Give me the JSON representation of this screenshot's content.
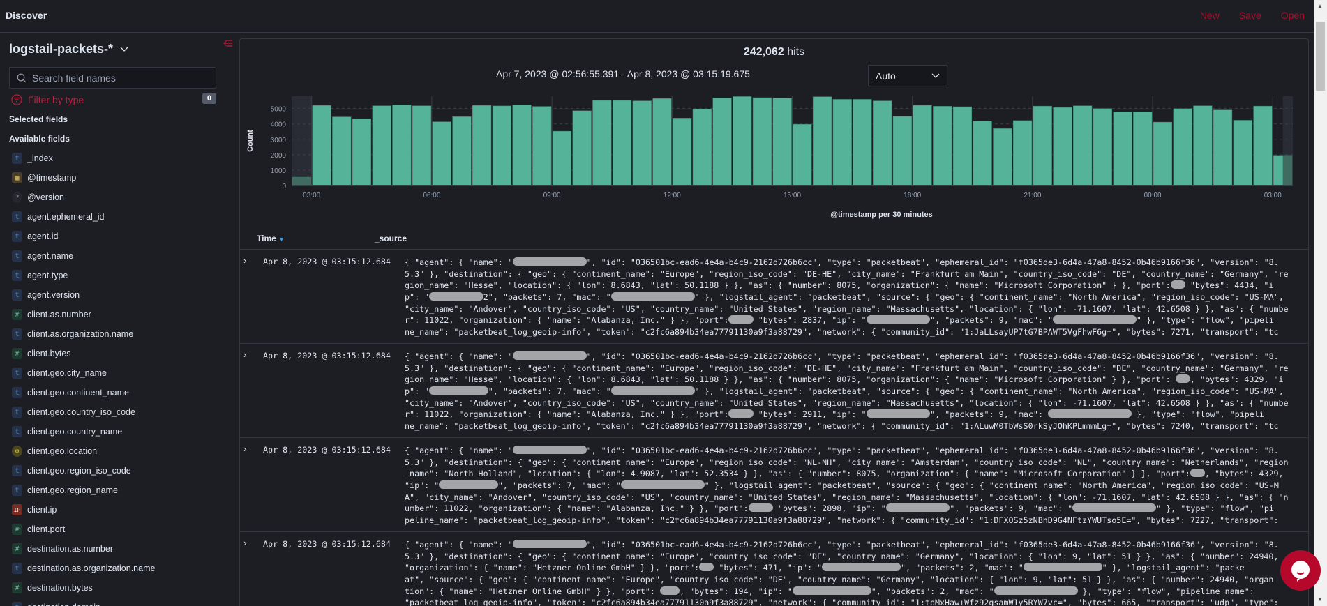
{
  "header": {
    "title": "Discover",
    "actions": [
      "New",
      "Save",
      "Open"
    ]
  },
  "sidebar": {
    "index_pattern": "logstail-packets-*",
    "search_placeholder": "Search field names",
    "filter_label": "Filter by type",
    "filter_count": "0",
    "selected_label": "Selected fields",
    "available_label": "Available fields",
    "fields": [
      {
        "name": "_index",
        "type": "string"
      },
      {
        "name": "@timestamp",
        "type": "date"
      },
      {
        "name": "@version",
        "type": "unknown"
      },
      {
        "name": "agent.ephemeral_id",
        "type": "string"
      },
      {
        "name": "agent.id",
        "type": "string"
      },
      {
        "name": "agent.name",
        "type": "string"
      },
      {
        "name": "agent.type",
        "type": "string"
      },
      {
        "name": "agent.version",
        "type": "string"
      },
      {
        "name": "client.as.number",
        "type": "number"
      },
      {
        "name": "client.as.organization.name",
        "type": "string"
      },
      {
        "name": "client.bytes",
        "type": "number"
      },
      {
        "name": "client.geo.city_name",
        "type": "string"
      },
      {
        "name": "client.geo.continent_name",
        "type": "string"
      },
      {
        "name": "client.geo.country_iso_code",
        "type": "string"
      },
      {
        "name": "client.geo.country_name",
        "type": "string"
      },
      {
        "name": "client.geo.location",
        "type": "geo"
      },
      {
        "name": "client.geo.region_iso_code",
        "type": "string"
      },
      {
        "name": "client.geo.region_name",
        "type": "string"
      },
      {
        "name": "client.ip",
        "type": "ip"
      },
      {
        "name": "client.port",
        "type": "number"
      },
      {
        "name": "destination.as.number",
        "type": "number"
      },
      {
        "name": "destination.as.organization.name",
        "type": "string"
      },
      {
        "name": "destination.bytes",
        "type": "number"
      },
      {
        "name": "destination.domain",
        "type": "string"
      }
    ]
  },
  "main": {
    "hits_count": "242,062",
    "hits_label": "hits",
    "time_range": "Apr 7, 2023 @ 02:56:55.391 - Apr 8, 2023 @ 03:15:19.675",
    "interval": "Auto",
    "table": {
      "col_time": "Time",
      "col_source": "_source"
    },
    "rows": [
      {
        "time": "Apr 8, 2023 @ 03:15:12.684",
        "lines": [
          "{ \"agent\": { \"name\": \"▮▮▮▮▮▮▮▮▮▮▮▮▮▮▮\", \"id\": \"036501bc-ead6-4e4a-b4c9-2162d726b6cc\", \"type\": \"packetbeat\", \"ephemeral_id\": \"f0365de3-6d4a-47a8-8452-0b46b9166f36\", \"version\": \"8.",
          "5.3\" }, \"destination\": { \"geo\": { \"continent_name\": \"Europe\", \"region_iso_code\": \"DE-HE\", \"city_name\": \"Frankfurt am Main\", \"country_iso_code\": \"DE\", \"country_name\": \"Germany\", \"re",
          "gion_name\": \"Hesse\", \"location\": { \"lon\": 8.6843, \"lat\": 50.1188 } }, \"as\": { \"number\": 8075, \"organization\": { \"name\": \"Microsoft Corporation\" } }, \"port\":▮▮▮ \"bytes\": 4434, \"i",
          "p\": \"▮▮▮▮▮▮▮▮▮▮▮2\", \"packets\": 7, \"mac\": \"▮▮▮▮▮▮▮▮▮▮▮▮▮▮▮▮▮\" }, \"logstail_agent\": \"packetbeat\", \"source\": { \"geo\": { \"continent_name\": \"North America\", \"region_iso_code\": \"US-MA\",",
          "\"city_name\": \"Andover\", \"country_iso_code\": \"US\", \"country_name\": \"United States\", \"region_name\": \"Massachusetts\", \"location\": { \"lon\": -71.1607, \"lat\": 42.6508 } }, \"as\": { \"numbe",
          "r\": 11022, \"organization\": { \"name\": \"Alabanza, Inc.\" } }, \"port\":▮▮▮▮▮ \"bytes\": 2837, \"ip\": \"▮▮▮▮▮▮▮▮▮▮▮▮▮\", \"packets\": 9, \"mac\": \"▮▮▮▮▮▮▮▮▮▮▮▮▮▮▮▮▮\" }, \"type\": \"flow\", \"pipeli",
          "ne_name\": \"packetbeat_log_geoip-info\", \"token\": \"c2fc6a894b34ea77791130a9f3a88729\", \"network\": { \"community_id\": \"1:JaLLsayUP7tG7BPAWT5VgFhwF6g=\", \"bytes\": 7271, \"transport\": \"tc"
        ]
      },
      {
        "time": "Apr 8, 2023 @ 03:15:12.684",
        "lines": [
          "{ \"agent\": { \"name\": \"▮▮▮▮▮▮▮▮▮▮▮▮▮▮▮\", \"id\": \"036501bc-ead6-4e4a-b4c9-2162d726b6cc\", \"type\": \"packetbeat\", \"ephemeral_id\": \"f0365de3-6d4a-47a8-8452-0b46b9166f36\", \"version\": \"8.",
          "5.3\" }, \"destination\": { \"geo\": { \"continent_name\": \"Europe\", \"region_iso_code\": \"DE-HE\", \"city_name\": \"Frankfurt am Main\", \"country_iso_code\": \"DE\", \"country_name\": \"Germany\", \"re",
          "gion_name\": \"Hesse\", \"location\": { \"lon\": 8.6843, \"lat\": 50.1188 } }, \"as\": { \"number\": 8075, \"organization\": { \"name\": \"Microsoft Corporation\" } }, \"port\": ▮▮▮, \"bytes\": 4329, \"i",
          "p\": \"▮▮▮▮▮▮▮▮▮▮▮▮\", \"packets\": 7, \"mac\": \"▮▮▮▮▮▮▮▮▮▮▮▮▮▮▮▮▮\" }, \"logstail_agent\": \"packetbeat\", \"source\": { \"geo\": { \"continent_name\": \"North America\", \"region_iso_code\": \"US-MA\",",
          "\"city_name\": \"Andover\", \"country_iso_code\": \"US\", \"country_name\": \"United States\", \"region_name\": \"Massachusetts\", \"location\": { \"lon\": -71.1607, \"lat\": 42.6508 } }, \"as\": { \"numbe",
          "r\": 11022, \"organization\": { \"name\": \"Alabanza, Inc.\" } }, \"port\":▮▮▮▮▮ \"bytes\": 2911, \"ip\": \"▮▮▮▮▮▮▮▮▮▮▮▮▮\", \"packets\": 9, \"mac\": ▮▮▮▮▮▮▮▮▮▮▮▮▮▮▮▮▮ }, \"type\": \"flow\", \"pipeli",
          "ne_name\": \"packetbeat_log_geoip-info\", \"token\": \"c2fc6a894b34ea77791130a9f3a88729\", \"network\": { \"community_id\": \"1:ALuwM0TbWsS0rkSyJOhKPLmmmLg=\", \"bytes\": 7240, \"transport\": \"tc"
        ]
      },
      {
        "time": "Apr 8, 2023 @ 03:15:12.684",
        "lines": [
          "{ \"agent\": { \"name\": \"▮▮▮▮▮▮▮▮▮▮▮▮▮▮▮\", \"id\": \"036501bc-ead6-4e4a-b4c9-2162d726b6cc\", \"type\": \"packetbeat\", \"ephemeral_id\": \"f0365de3-6d4a-47a8-8452-0b46b9166f36\", \"version\": \"8.",
          "5.3\" }, \"destination\": { \"geo\": { \"continent_name\": \"Europe\", \"region_iso_code\": \"NL-NH\", \"city_name\": \"Amsterdam\", \"country_iso_code\": \"NL\", \"country_name\": \"Netherlands\", \"region",
          "_name\": \"North Holland\", \"location\": { \"lon\": 4.9087, \"lat\": 52.3534 } }, \"as\": { \"number\": 8075, \"organization\": { \"name\": \"Microsoft Corporation\" } }, \"port\":▮▮▮, \"bytes\": 4329,",
          "\"ip\": \"▮▮▮▮▮▮▮▮▮▮▮▮\", \"packets\": 7, \"mac\": \"▮▮▮▮▮▮▮▮▮▮▮▮▮▮▮▮▮\" }, \"logstail_agent\": \"packetbeat\", \"source\": { \"geo\": { \"continent_name\": \"North America\", \"region_iso_code\": \"US-M",
          "A\", \"city_name\": \"Andover\", \"country_iso_code\": \"US\", \"country_name\": \"United States\", \"region_name\": \"Massachusetts\", \"location\": { \"lon\": -71.1607, \"lat\": 42.6508 } }, \"as\": { \"n",
          "umber\": 11022, \"organization\": { \"name\": \"Alabanza, Inc.\" } }, \"port\":▮▮▮▮▮ \"bytes\": 2898, \"ip\": \"▮▮▮▮▮▮▮▮▮▮▮▮▮\", \"packets\": 9, \"mac\": \"▮▮▮▮▮▮▮▮▮▮▮▮▮▮▮▮▮\" }, \"type\": \"flow\", \"pi",
          "peline_name\": \"packetbeat_log_geoip-info\", \"token\": \"c2fc6a894b34ea77791130a9f3a88729\", \"network\": { \"community_id\": \"1:DFXOSz5zNBhD9G4NFtzYWUTso5E=\", \"bytes\": 7227, \"transport\":"
        ]
      },
      {
        "time": "Apr 8, 2023 @ 03:15:12.684",
        "lines": [
          "{ \"agent\": { \"name\": \"▮▮▮▮▮▮▮▮▮▮▮▮▮▮▮\", \"id\": \"036501bc-ead6-4e4a-b4c9-2162d726b6cc\", \"type\": \"packetbeat\", \"ephemeral_id\": \"f0365de3-6d4a-47a8-8452-0b46b9166f36\", \"version\": \"8.",
          "5.3\" }, \"destination\": { \"geo\": { \"continent_name\": \"Europe\", \"country_iso_code\": \"DE\", \"country_name\": \"Germany\", \"location\": { \"lon\": 9, \"lat\": 51 } }, \"as\": { \"number\": 24940,",
          "\"organization\": { \"name\": \"Hetzner Online GmbH\" } }, \"port\":▮▮▮ \"bytes\": 471, \"ip\": \"▮▮▮▮▮▮▮▮▮▮▮▮▮▮▮▮\", \"packets\": 2, \"mac\": \"▮▮▮▮▮▮▮▮▮▮▮▮▮▮▮▮\" }, \"logstail_agent\": \"packe",
          "at\", \"source\": { \"geo\": { \"continent_name\": \"Europe\", \"country_iso_code\": \"DE\", \"country_name\": \"Germany\", \"location\": { \"lon\": 9, \"lat\": 51 } }, \"as\": { \"number\": 24940, \"organ",
          "tion\": { \"name\": \"Hetzner Online GmbH\" } }, \"port\": ▮▮▮▮, \"bytes\": 194, \"ip\": \"▮▮▮▮▮▮▮▮▮▮▮▮▮▮▮▮\", \"packets\": 2, \"mac\": \"▮▮▮▮▮▮▮▮▮▮▮▮▮▮▮▮▮ }, \"type\": \"flow\", \"pipeline_name\":",
          "\"packetbeat_log_geoip-info\", \"token\": \"c2fc6a894b34ea77791130a9f3a88729\", \"network\": { \"community_id\": \"1:tpMxHaw+Wfz92gsamW1y5RYW7vc=\", \"bytes\": 665, \"transport\": \"udp\", \"type\":"
        ]
      }
    ]
  },
  "chart_data": {
    "type": "bar",
    "ylabel": "Count",
    "xlabel": "@timestamp per 30 minutes",
    "x_start": "Apr 7, 2023 02:30",
    "bin_minutes": 30,
    "x_ticks": [
      "03:00",
      "06:00",
      "09:00",
      "12:00",
      "15:00",
      "18:00",
      "21:00",
      "00:00",
      "03:00"
    ],
    "y_ticks": [
      0,
      1000,
      2000,
      3000,
      4000,
      5000
    ],
    "ylim": [
      0,
      5800
    ],
    "grid": "dashed horizontal",
    "bar_color": "#54b399",
    "out_of_range_start": "Apr 7, 2023 02:56:55",
    "out_of_range_end": "Apr 8, 2023 03:15:19",
    "values": [
      540,
      5200,
      4460,
      4340,
      5180,
      5240,
      5180,
      4140,
      4470,
      5200,
      5170,
      5240,
      5140,
      3530,
      4860,
      5530,
      5530,
      5500,
      5650,
      4380,
      4970,
      5690,
      5780,
      5710,
      5680,
      3980,
      5770,
      5600,
      5600,
      5500,
      4490,
      5210,
      5150,
      5120,
      4180,
      3700,
      4220,
      5160,
      5070,
      5180,
      5000,
      4790,
      4790,
      4120,
      4990,
      5180,
      4910,
      4240,
      5160,
      1960
    ]
  },
  "colors": {
    "accent": "#bd1e3c",
    "bars": "#54b399",
    "background": "#1d1e24"
  }
}
